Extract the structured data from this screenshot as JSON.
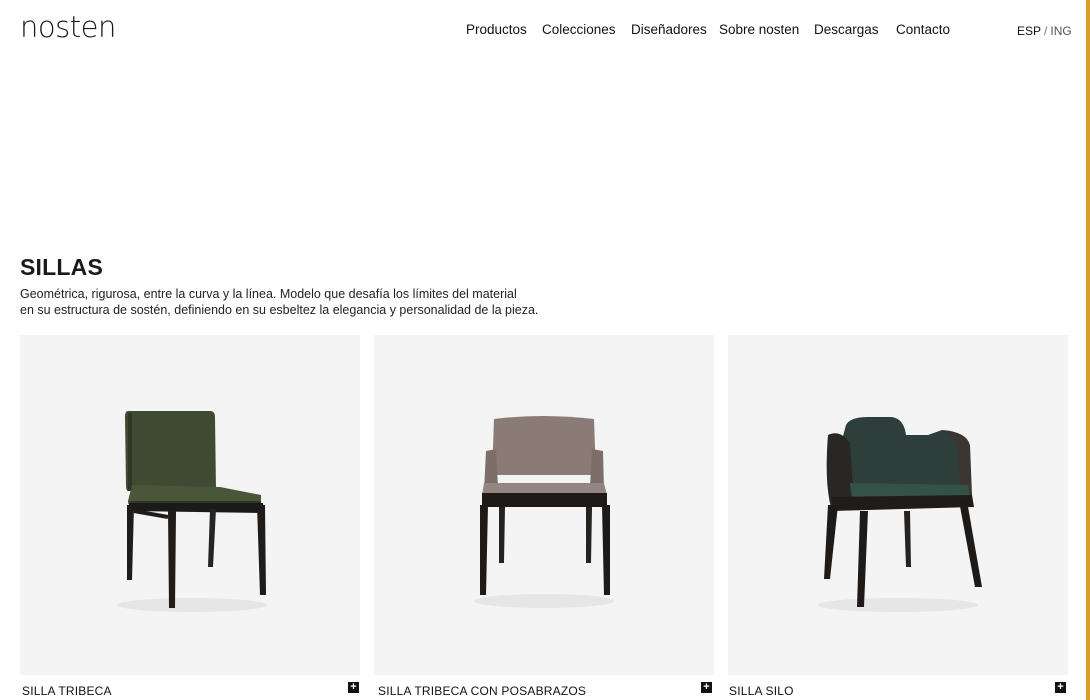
{
  "brand": {
    "logo": "nosten",
    "accent_color": "#d79e2a"
  },
  "nav": {
    "items": [
      {
        "label": "Productos"
      },
      {
        "label": "Colecciones"
      },
      {
        "label": "Diseñadores"
      },
      {
        "label": "Sobre nosten"
      },
      {
        "label": "Descargas"
      },
      {
        "label": "Contacto"
      }
    ]
  },
  "language": {
    "active": "ESP",
    "separator": "/",
    "other": "ING"
  },
  "category": {
    "title": "SILLAS",
    "description_line1": "Geométrica, rigurosa, entre la curva y la línea. Modelo que desafía los límites del material",
    "description_line2": "en su estructura de sostén, definiendo en su esbeltez la elegancia y personalidad de la pieza."
  },
  "products": [
    {
      "name": "SILLA TRIBECA",
      "upholstery_color": "#3f4a32",
      "icon": "plus-icon"
    },
    {
      "name": "SILLA TRIBECA CON POSABRAZOS",
      "upholstery_color": "#8b7b77",
      "icon": "plus-icon"
    },
    {
      "name": "SILLA SILO",
      "upholstery_color": "#2d3e3b",
      "icon": "plus-icon"
    }
  ]
}
